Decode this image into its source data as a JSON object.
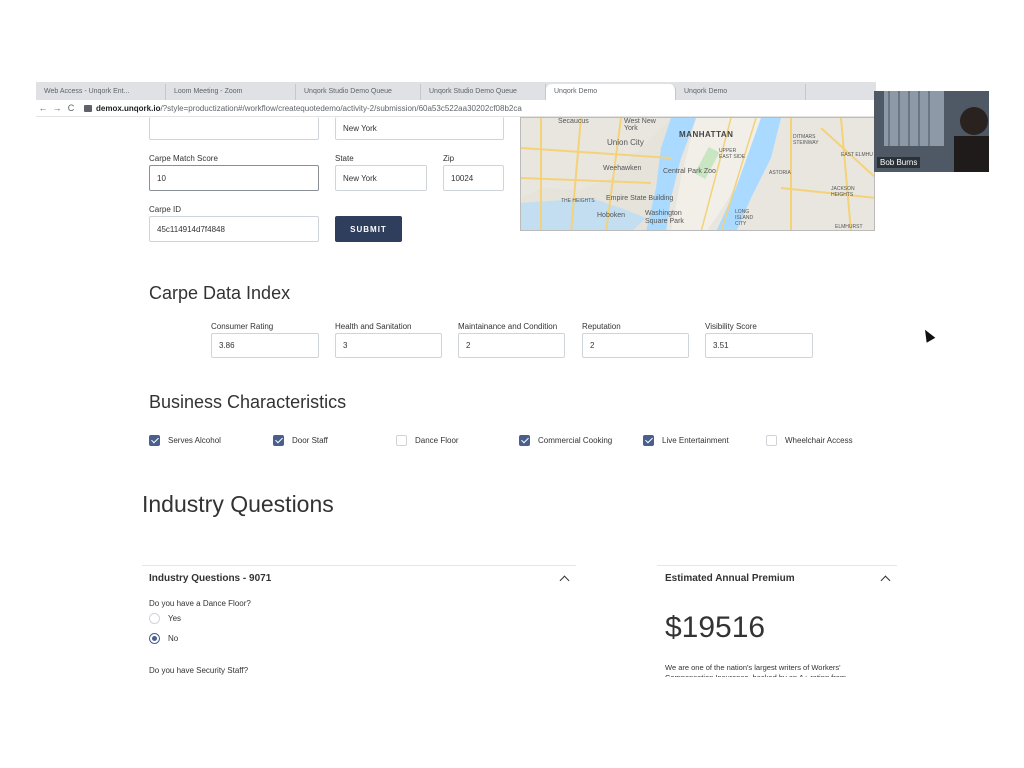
{
  "browser": {
    "tabs": [
      "Web Access - Unqork Ent...",
      "Loom Meeting - Zoom",
      "Unqork Studio Demo Queue",
      "Unqork Studio Demo Queue",
      "Unqork Demo",
      "Unqork Demo"
    ],
    "back_icon": "←",
    "forward_icon": "→",
    "reload_icon": "C",
    "url_host": "demox.unqork.io",
    "url_path": "/?style=productization#/workflow/createquotedemo/activity-2/submission/60a53c522aa30202cf08b2ca"
  },
  "form": {
    "city_value": "New York",
    "carpe_match_label": "Carpe Match Score",
    "carpe_match_value": "10",
    "state_label": "State",
    "state_value": "New York",
    "zip_label": "Zip",
    "zip_value": "10024",
    "carpe_id_label": "Carpe ID",
    "carpe_id_value": "45c114914d7f4848",
    "submit_label": "SUBMIT"
  },
  "map": {
    "labels": {
      "secaucus": "Secaucus",
      "west_new_york": "West New York",
      "manhattan": "MANHATTAN",
      "union_city": "Union City",
      "upper_east_side": "UPPER EAST SIDE",
      "ditmars": "DITMARS STEINWAY",
      "east_elmhurst": "EAST ELMHU",
      "weehawken": "Weehawken",
      "central_park_zoo": "Central Park Zoo",
      "astoria": "ASTORIA",
      "jackson_heights": "JACKSON HEIGHTS",
      "the_heights": "THE HEIGHTS",
      "empire_state": "Empire State Building",
      "hoboken": "Hoboken",
      "washington_sq": "Washington Square Park",
      "long_island_city": "LONG ISLAND CITY",
      "elmhurst": "ELMHURST"
    }
  },
  "carpe_index": {
    "title": "Carpe Data Index",
    "fields": [
      {
        "label": "Consumer Rating",
        "value": "3.86"
      },
      {
        "label": "Health and Sanitation",
        "value": "3"
      },
      {
        "label": "Maintainance and Condition",
        "value": "2"
      },
      {
        "label": "Reputation",
        "value": "2"
      },
      {
        "label": "Visibility Score",
        "value": "3.51"
      }
    ]
  },
  "business": {
    "title": "Business Characteristics",
    "items": [
      {
        "label": "Serves Alcohol",
        "checked": true
      },
      {
        "label": "Door Staff",
        "checked": true
      },
      {
        "label": "Dance Floor",
        "checked": false
      },
      {
        "label": "Commercial Cooking",
        "checked": true
      },
      {
        "label": "Live Entertainment",
        "checked": true
      },
      {
        "label": "Wheelchair Access",
        "checked": false
      }
    ]
  },
  "industry": {
    "heading": "Industry Questions",
    "panel_title": "Industry Questions - 9071",
    "q1": "Do you have a Dance Floor?",
    "yes_label": "Yes",
    "no_label": "No",
    "q1_selected": "No",
    "q2": "Do you have Security Staff?"
  },
  "premium": {
    "panel_title": "Estimated Annual Premium",
    "amount": "$19516",
    "description": "We are one of the nation's largest writers of Workers' Compensation Insurance, backed by an A+ rating from"
  },
  "video": {
    "participant_name": "Bob Burns"
  },
  "colors": {
    "submit_bg": "#2f3e5c",
    "checkbox_checked": "#4a5f8c"
  }
}
